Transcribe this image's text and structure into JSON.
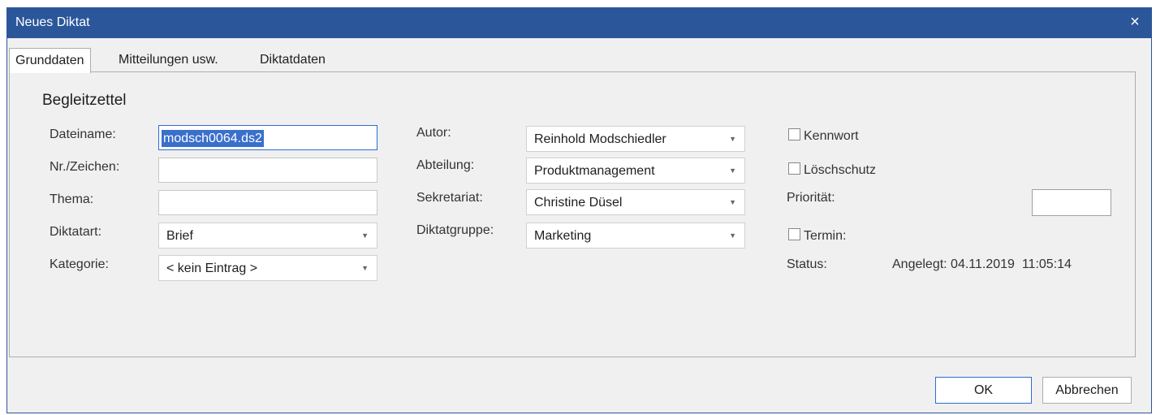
{
  "window": {
    "title": "Neues Diktat",
    "close_symbol": "×"
  },
  "tabs": [
    {
      "label": "Grunddaten",
      "active": true
    },
    {
      "label": "Mitteilungen usw.",
      "active": false
    },
    {
      "label": "Diktatdaten",
      "active": false
    }
  ],
  "section_title": "Begleitzettel",
  "left": {
    "dateiname_label": "Dateiname:",
    "dateiname_value": "modsch0064.ds2",
    "nr_label": "Nr./Zeichen:",
    "nr_value": "",
    "thema_label": "Thema:",
    "thema_value": "",
    "diktatart_label": "Diktatart:",
    "diktatart_value": "Brief",
    "kategorie_label": "Kategorie:",
    "kategorie_value": "< kein Eintrag >"
  },
  "middle": {
    "autor_label": "Autor:",
    "autor_value": "Reinhold Modschiedler",
    "abteilung_label": "Abteilung:",
    "abteilung_value": "Produktmanagement",
    "sekretariat_label": "Sekretariat:",
    "sekretariat_value": "Christine Düsel",
    "diktatgruppe_label": "Diktatgruppe:",
    "diktatgruppe_value": "Marketing"
  },
  "right": {
    "kennwort_label": "Kennwort",
    "kennwort_checked": false,
    "loeschschutz_label": "Löschschutz",
    "loeschschutz_checked": false,
    "prioritaet_label": "Priorität:",
    "prioritaet_value": "",
    "termin_label": "Termin:",
    "termin_checked": false,
    "status_label": "Status:",
    "status_value": "Angelegt: 04.11.2019  11:05:14"
  },
  "buttons": {
    "ok": "OK",
    "cancel": "Abbrechen"
  },
  "icons": {
    "dropdown": "▼"
  },
  "colors": {
    "titlebar": "#2b579a",
    "selection": "#3a6fcb"
  }
}
